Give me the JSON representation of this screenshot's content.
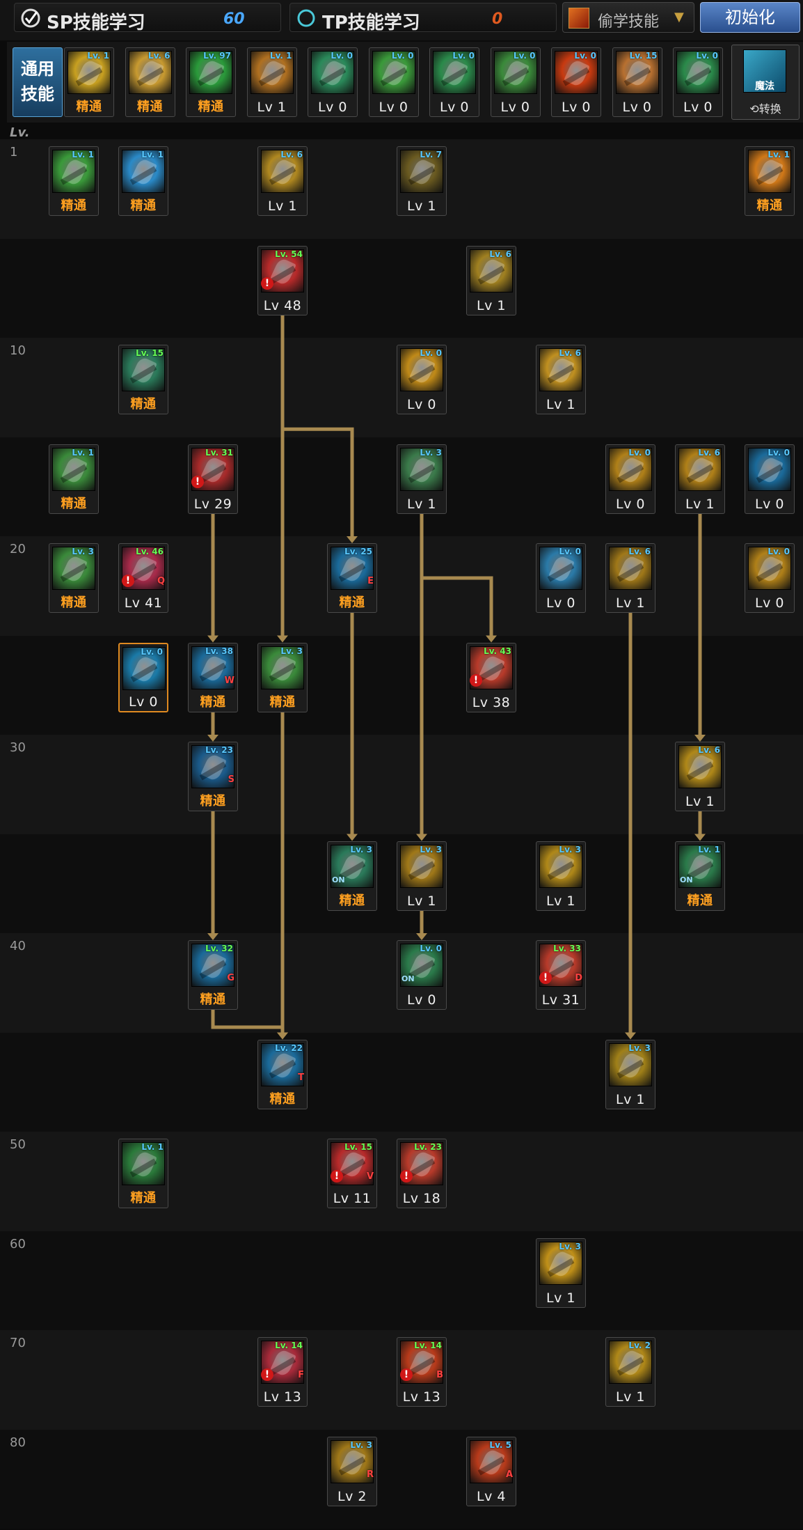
{
  "topbar": {
    "sp_label": "SP技能学习",
    "sp_value": "60",
    "tp_label": "TP技能学习",
    "tp_value": "0",
    "steal_label": "偷学技能",
    "reset_label": "初始化"
  },
  "common": {
    "label_line1": "通用",
    "label_line2": "技能",
    "switch_mode": "魔法",
    "switch_label": "⟲转换",
    "skills": [
      {
        "badge": "Lv. 1",
        "foot": "精通",
        "mastered": true,
        "color": "#c8a020"
      },
      {
        "badge": "Lv. 6",
        "foot": "精通",
        "mastered": true,
        "color": "#c89a30"
      },
      {
        "badge": "Lv. 97",
        "foot": "精通",
        "mastered": true,
        "color": "#2a9a3a"
      },
      {
        "badge": "Lv. 1",
        "foot": "Lv 1",
        "mastered": false,
        "color": "#b07020"
      },
      {
        "badge": "Lv. 0",
        "foot": "Lv 0",
        "mastered": false,
        "color": "#2a8a5a"
      },
      {
        "badge": "Lv. 0",
        "foot": "Lv 0",
        "mastered": false,
        "color": "#3a9a3a"
      },
      {
        "badge": "Lv. 0",
        "foot": "Lv 0",
        "mastered": false,
        "color": "#2a8a4a"
      },
      {
        "badge": "Lv. 0",
        "foot": "Lv 0",
        "mastered": false,
        "color": "#3a8a3a"
      },
      {
        "badge": "Lv. 0",
        "foot": "Lv 0",
        "mastered": false,
        "color": "#c83a10"
      },
      {
        "badge": "Lv. 15",
        "foot": "Lv 0",
        "mastered": false,
        "color": "#b87030"
      },
      {
        "badge": "Lv. 0",
        "foot": "Lv 0",
        "mastered": false,
        "color": "#2a8a4a"
      }
    ]
  },
  "tree": {
    "level_header": "Lv.",
    "row_labels": [
      "1",
      "",
      "10",
      "",
      "20",
      "",
      "30",
      "",
      "40",
      "",
      "50",
      "60",
      "70",
      "80"
    ],
    "skills": [
      {
        "row": 0,
        "col": 0,
        "badge": "Lv. 1",
        "foot": "精通",
        "mastered": true,
        "color": "#3a9a3a"
      },
      {
        "row": 0,
        "col": 1,
        "badge": "Lv. 1",
        "foot": "精通",
        "mastered": true,
        "color": "#2a8ac8"
      },
      {
        "row": 0,
        "col": 3,
        "badge": "Lv. 6",
        "foot": "Lv 1",
        "mastered": false,
        "color": "#b08820"
      },
      {
        "row": 0,
        "col": 5,
        "badge": "Lv. 7",
        "foot": "Lv 1",
        "mastered": false,
        "color": "#6a5a20"
      },
      {
        "row": 0,
        "col": 10,
        "badge": "Lv. 1",
        "foot": "精通",
        "mastered": true,
        "color": "#d07818"
      },
      {
        "row": 1,
        "col": 3,
        "badge": "Lv. 54",
        "foot": "Lv 48",
        "mastered": false,
        "green": true,
        "warn": true,
        "color": "#b82a2a"
      },
      {
        "row": 1,
        "col": 6,
        "badge": "Lv. 6",
        "foot": "Lv 1",
        "mastered": false,
        "color": "#a08020"
      },
      {
        "row": 2,
        "col": 1,
        "badge": "Lv. 15",
        "foot": "精通",
        "mastered": true,
        "green": true,
        "color": "#2a7a5a"
      },
      {
        "row": 2,
        "col": 5,
        "badge": "Lv. 0",
        "foot": "Lv 0",
        "mastered": false,
        "color": "#c08a18"
      },
      {
        "row": 2,
        "col": 7,
        "badge": "Lv. 6",
        "foot": "Lv 1",
        "mastered": false,
        "color": "#c09020"
      },
      {
        "row": 3,
        "col": 0,
        "badge": "Lv. 1",
        "foot": "精通",
        "mastered": true,
        "color": "#3a8a3a"
      },
      {
        "row": 3,
        "col": 2,
        "badge": "Lv. 31",
        "foot": "Lv 29",
        "mastered": false,
        "green": true,
        "warn": true,
        "color": "#a82a2a"
      },
      {
        "row": 3,
        "col": 5,
        "badge": "Lv. 3",
        "foot": "Lv 1",
        "mastered": false,
        "color": "#3a7a4a"
      },
      {
        "row": 3,
        "col": 8,
        "badge": "Lv. 0",
        "foot": "Lv 0",
        "mastered": false,
        "color": "#b08018"
      },
      {
        "row": 3,
        "col": 9,
        "badge": "Lv. 6",
        "foot": "Lv 1",
        "mastered": false,
        "color": "#b08018"
      },
      {
        "row": 3,
        "col": 10,
        "badge": "Lv. 0",
        "foot": "Lv 0",
        "mastered": false,
        "color": "#1a6a9a"
      },
      {
        "row": 4,
        "col": 0,
        "badge": "Lv. 3",
        "foot": "精通",
        "mastered": true,
        "color": "#3a8a3a"
      },
      {
        "row": 4,
        "col": 1,
        "badge": "Lv. 46",
        "foot": "Lv 41",
        "mastered": false,
        "green": true,
        "warn": true,
        "key": "Q",
        "color": "#a82a4a"
      },
      {
        "row": 4,
        "col": 4,
        "badge": "Lv. 25",
        "foot": "精通",
        "mastered": true,
        "key": "E",
        "color": "#1a6a9a"
      },
      {
        "row": 4,
        "col": 7,
        "badge": "Lv. 0",
        "foot": "Lv 0",
        "mastered": false,
        "color": "#2a7aa8"
      },
      {
        "row": 4,
        "col": 8,
        "badge": "Lv. 6",
        "foot": "Lv 1",
        "mastered": false,
        "color": "#a07818"
      },
      {
        "row": 4,
        "col": 10,
        "badge": "Lv. 0",
        "foot": "Lv 0",
        "mastered": false,
        "color": "#b08018"
      },
      {
        "row": 5,
        "col": 1,
        "badge": "Lv. 0",
        "foot": "Lv 0",
        "mastered": false,
        "selected": true,
        "color": "#1a7aa8"
      },
      {
        "row": 5,
        "col": 2,
        "badge": "Lv. 38",
        "foot": "精通",
        "mastered": true,
        "key": "W",
        "color": "#1a6a9a"
      },
      {
        "row": 5,
        "col": 3,
        "badge": "Lv. 3",
        "foot": "精通",
        "mastered": true,
        "color": "#3a8a3a"
      },
      {
        "row": 5,
        "col": 6,
        "badge": "Lv. 43",
        "foot": "Lv 38",
        "mastered": false,
        "green": true,
        "warn": true,
        "color": "#b83a2a"
      },
      {
        "row": 6,
        "col": 2,
        "badge": "Lv. 23",
        "foot": "精通",
        "mastered": true,
        "key": "S",
        "color": "#1a5a8a"
      },
      {
        "row": 6,
        "col": 9,
        "badge": "Lv. 6",
        "foot": "Lv 1",
        "mastered": false,
        "color": "#b08818"
      },
      {
        "row": 7,
        "col": 4,
        "badge": "Lv. 3",
        "foot": "精通",
        "mastered": true,
        "on": true,
        "color": "#2a7a5a"
      },
      {
        "row": 7,
        "col": 5,
        "badge": "Lv. 3",
        "foot": "Lv 1",
        "mastered": false,
        "color": "#a07818"
      },
      {
        "row": 7,
        "col": 7,
        "badge": "Lv. 3",
        "foot": "Lv 1",
        "mastered": false,
        "color": "#b08818"
      },
      {
        "row": 7,
        "col": 9,
        "badge": "Lv. 1",
        "foot": "精通",
        "mastered": true,
        "on": true,
        "color": "#2a7a4a"
      },
      {
        "row": 8,
        "col": 2,
        "badge": "Lv. 32",
        "foot": "精通",
        "mastered": true,
        "green": true,
        "key": "G",
        "color": "#1a6a9a"
      },
      {
        "row": 8,
        "col": 5,
        "badge": "Lv. 0",
        "foot": "Lv 0",
        "mastered": false,
        "on": true,
        "color": "#2a7a4a"
      },
      {
        "row": 8,
        "col": 7,
        "badge": "Lv. 33",
        "foot": "Lv 31",
        "mastered": false,
        "green": true,
        "warn": true,
        "key": "D",
        "color": "#b83a2a"
      },
      {
        "row": 9,
        "col": 3,
        "badge": "Lv. 22",
        "foot": "精通",
        "mastered": true,
        "key": "T",
        "color": "#1a6a9a"
      },
      {
        "row": 9,
        "col": 8,
        "badge": "Lv. 3",
        "foot": "Lv 1",
        "mastered": false,
        "color": "#a08018"
      },
      {
        "row": 10,
        "col": 1,
        "badge": "Lv. 1",
        "foot": "精通",
        "mastered": true,
        "color": "#2a7a3a"
      },
      {
        "row": 10,
        "col": 4,
        "badge": "Lv. 15",
        "foot": "Lv 11",
        "mastered": false,
        "green": true,
        "warn": true,
        "key": "V",
        "color": "#b82a2a"
      },
      {
        "row": 10,
        "col": 5,
        "badge": "Lv. 23",
        "foot": "Lv 18",
        "mastered": false,
        "green": true,
        "warn": true,
        "color": "#b83a2a"
      },
      {
        "row": 11,
        "col": 7,
        "badge": "Lv. 3",
        "foot": "Lv 1",
        "mastered": false,
        "color": "#c09018"
      },
      {
        "row": 12,
        "col": 3,
        "badge": "Lv. 14",
        "foot": "Lv 13",
        "mastered": false,
        "green": true,
        "warn": true,
        "key": "F",
        "color": "#a82a3a"
      },
      {
        "row": 12,
        "col": 5,
        "badge": "Lv. 14",
        "foot": "Lv 13",
        "mastered": false,
        "green": true,
        "warn": true,
        "key": "B",
        "color": "#b83a1a"
      },
      {
        "row": 12,
        "col": 8,
        "badge": "Lv. 2",
        "foot": "Lv 1",
        "mastered": false,
        "color": "#b08818"
      },
      {
        "row": 13,
        "col": 4,
        "badge": "Lv. 3",
        "foot": "Lv 2",
        "mastered": false,
        "key": "R",
        "color": "#a07818"
      },
      {
        "row": 13,
        "col": 6,
        "badge": "Lv. 5",
        "foot": "Lv 4",
        "mastered": false,
        "key": "A",
        "color": "#b83a1a"
      }
    ],
    "links": [
      {
        "from": [
          1,
          3
        ],
        "to": [
          5,
          3
        ]
      },
      {
        "from": [
          1,
          3
        ],
        "to": [
          4,
          4
        ],
        "via": "h"
      },
      {
        "from": [
          3,
          2
        ],
        "to": [
          5,
          2
        ]
      },
      {
        "from": [
          5,
          2
        ],
        "to": [
          6,
          2
        ]
      },
      {
        "from": [
          6,
          2
        ],
        "to": [
          8,
          2
        ]
      },
      {
        "from": [
          8,
          2
        ],
        "to": [
          9,
          3
        ],
        "via": "h2"
      },
      {
        "from": [
          5,
          3
        ],
        "to": [
          9,
          3
        ]
      },
      {
        "from": [
          4,
          4
        ],
        "to": [
          7,
          4
        ]
      },
      {
        "from": [
          3,
          5
        ],
        "to": [
          7,
          5
        ]
      },
      {
        "from": [
          3,
          5
        ],
        "to": [
          5,
          6
        ],
        "via": "h"
      },
      {
        "from": [
          7,
          5
        ],
        "to": [
          8,
          5
        ]
      },
      {
        "from": [
          4,
          8
        ],
        "to": [
          9,
          8
        ]
      },
      {
        "from": [
          3,
          9
        ],
        "to": [
          6,
          9
        ]
      },
      {
        "from": [
          6,
          9
        ],
        "to": [
          7,
          9
        ]
      }
    ]
  }
}
